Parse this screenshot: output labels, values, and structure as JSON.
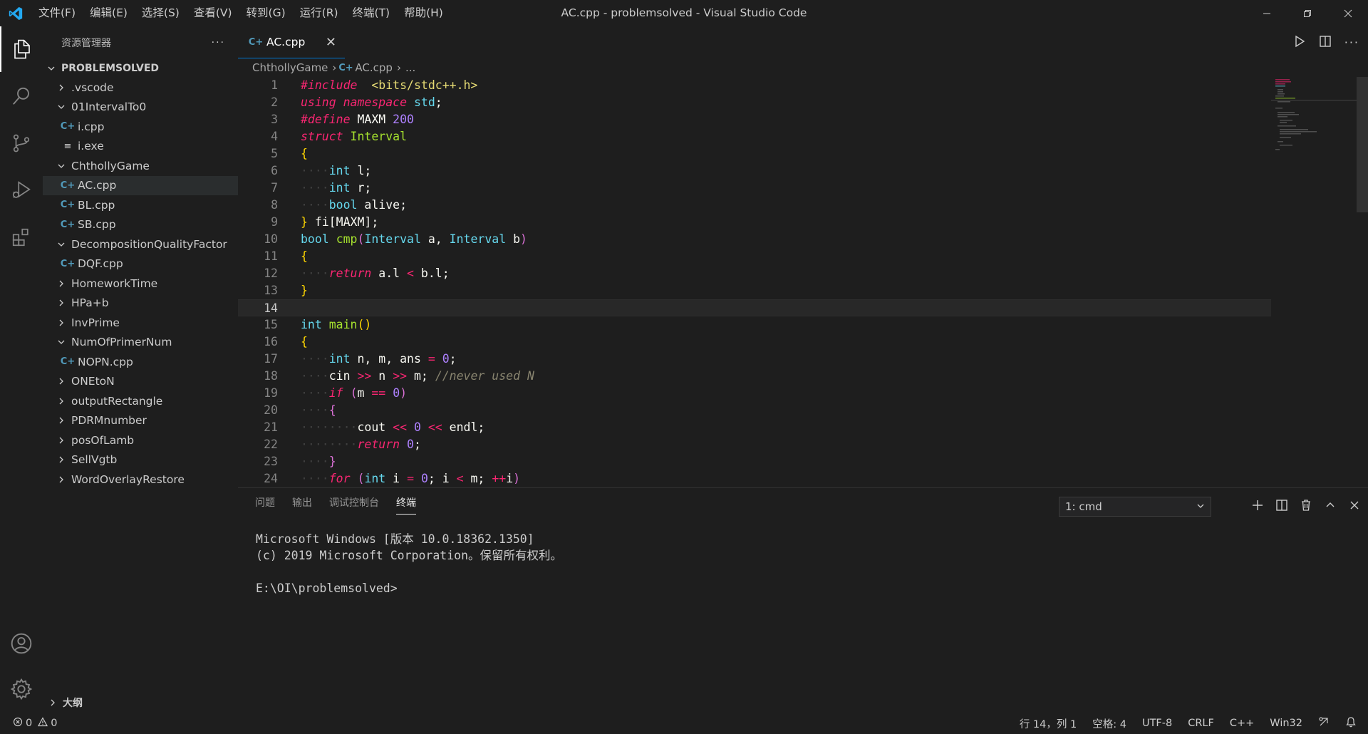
{
  "window": {
    "title": "AC.cpp - problemsolved - Visual Studio Code"
  },
  "menu": [
    "文件(F)",
    "编辑(E)",
    "选择(S)",
    "查看(V)",
    "转到(G)",
    "运行(R)",
    "终端(T)",
    "帮助(H)"
  ],
  "sidebar": {
    "header": "资源管理器",
    "section": "PROBLEMSOLVED",
    "tree": [
      {
        "label": ".vscode",
        "type": "folder",
        "expanded": false,
        "depth": 0
      },
      {
        "label": "01IntervalTo0",
        "type": "folder",
        "expanded": true,
        "depth": 0
      },
      {
        "label": "i.cpp",
        "type": "cpp",
        "depth": 1
      },
      {
        "label": "i.exe",
        "type": "exe",
        "depth": 1
      },
      {
        "label": "ChthollyGame",
        "type": "folder",
        "expanded": true,
        "depth": 0
      },
      {
        "label": "AC.cpp",
        "type": "cpp",
        "depth": 1,
        "selected": true
      },
      {
        "label": "BL.cpp",
        "type": "cpp",
        "depth": 1
      },
      {
        "label": "SB.cpp",
        "type": "cpp",
        "depth": 1
      },
      {
        "label": "DecompositionQualityFactor",
        "type": "folder",
        "expanded": true,
        "depth": 0
      },
      {
        "label": "DQF.cpp",
        "type": "cpp",
        "depth": 1
      },
      {
        "label": "HomeworkTime",
        "type": "folder",
        "expanded": false,
        "depth": 0
      },
      {
        "label": "HPa+b",
        "type": "folder",
        "expanded": false,
        "depth": 0
      },
      {
        "label": "InvPrime",
        "type": "folder",
        "expanded": false,
        "depth": 0
      },
      {
        "label": "NumOfPrimerNum",
        "type": "folder",
        "expanded": true,
        "depth": 0
      },
      {
        "label": "NOPN.cpp",
        "type": "cpp",
        "depth": 1
      },
      {
        "label": "ONEtoN",
        "type": "folder",
        "expanded": false,
        "depth": 0
      },
      {
        "label": "outputRectangle",
        "type": "folder",
        "expanded": false,
        "depth": 0
      },
      {
        "label": "PDRMnumber",
        "type": "folder",
        "expanded": false,
        "depth": 0
      },
      {
        "label": "posOfLamb",
        "type": "folder",
        "expanded": false,
        "depth": 0
      },
      {
        "label": "SellVgtb",
        "type": "folder",
        "expanded": false,
        "depth": 0
      },
      {
        "label": "WordOverlayRestore",
        "type": "folder",
        "expanded": false,
        "depth": 0
      }
    ],
    "outline": "大纲"
  },
  "editor": {
    "tab": "AC.cpp",
    "breadcrumb": [
      "ChthollyGame",
      "AC.cpp",
      "..."
    ],
    "current_line": 14,
    "lines": [
      [
        [
          "pp-it",
          "#include"
        ],
        [
          "",
          "  "
        ],
        [
          "str",
          "<bits/stdc++.h>"
        ]
      ],
      [
        [
          "kw-it",
          "using"
        ],
        [
          "",
          " "
        ],
        [
          "kw-it",
          "namespace"
        ],
        [
          "",
          " "
        ],
        [
          "type",
          "std"
        ],
        [
          "",
          ";"
        ]
      ],
      [
        [
          "pp-it",
          "#define"
        ],
        [
          "",
          " MAXM "
        ],
        [
          "num",
          "200"
        ]
      ],
      [
        [
          "kw-it",
          "struct"
        ],
        [
          "",
          " "
        ],
        [
          "fn",
          "Interval"
        ]
      ],
      [
        [
          "brace1",
          "{"
        ]
      ],
      [
        [
          "guide",
          "····"
        ],
        [
          "type",
          "int"
        ],
        [
          "",
          " l;"
        ]
      ],
      [
        [
          "guide",
          "····"
        ],
        [
          "type",
          "int"
        ],
        [
          "",
          " r;"
        ]
      ],
      [
        [
          "guide",
          "····"
        ],
        [
          "type",
          "bool"
        ],
        [
          "",
          " alive;"
        ]
      ],
      [
        [
          "brace1",
          "}"
        ],
        [
          "",
          " fi[MAXM];"
        ]
      ],
      [
        [
          "type",
          "bool"
        ],
        [
          "",
          " "
        ],
        [
          "fn",
          "cmp"
        ],
        [
          "brace2",
          "("
        ],
        [
          "type",
          "Interval"
        ],
        [
          "",
          " a, "
        ],
        [
          "type",
          "Interval"
        ],
        [
          "",
          " b"
        ],
        [
          "brace2",
          ")"
        ]
      ],
      [
        [
          "brace1",
          "{"
        ]
      ],
      [
        [
          "guide",
          "····"
        ],
        [
          "kw-it",
          "return"
        ],
        [
          "",
          " a.l "
        ],
        [
          "op",
          "<"
        ],
        [
          "",
          " b.l;"
        ]
      ],
      [
        [
          "brace1",
          "}"
        ]
      ],
      [],
      [
        [
          "type",
          "int"
        ],
        [
          "",
          " "
        ],
        [
          "fn",
          "main"
        ],
        [
          "brace1",
          "()"
        ]
      ],
      [
        [
          "brace1",
          "{"
        ]
      ],
      [
        [
          "guide",
          "····"
        ],
        [
          "type",
          "int"
        ],
        [
          "",
          " n, m, ans "
        ],
        [
          "op",
          "="
        ],
        [
          "",
          " "
        ],
        [
          "num",
          "0"
        ],
        [
          "",
          ";"
        ]
      ],
      [
        [
          "guide",
          "····"
        ],
        [
          "",
          "cin "
        ],
        [
          "op",
          ">>"
        ],
        [
          "",
          " n "
        ],
        [
          "op",
          ">>"
        ],
        [
          "",
          " m; "
        ],
        [
          "cmt",
          "//never used N"
        ]
      ],
      [
        [
          "guide",
          "····"
        ],
        [
          "kw-it",
          "if"
        ],
        [
          "",
          " "
        ],
        [
          "brace2",
          "("
        ],
        [
          "",
          "m "
        ],
        [
          "op",
          "=="
        ],
        [
          "",
          " "
        ],
        [
          "num",
          "0"
        ],
        [
          "brace2",
          ")"
        ]
      ],
      [
        [
          "guide",
          "····"
        ],
        [
          "brace2",
          "{"
        ]
      ],
      [
        [
          "guide",
          "········"
        ],
        [
          "",
          "cout "
        ],
        [
          "op",
          "<<"
        ],
        [
          "",
          " "
        ],
        [
          "num",
          "0"
        ],
        [
          "",
          " "
        ],
        [
          "op",
          "<<"
        ],
        [
          "",
          " endl;"
        ]
      ],
      [
        [
          "guide",
          "········"
        ],
        [
          "kw-it",
          "return"
        ],
        [
          "",
          " "
        ],
        [
          "num",
          "0"
        ],
        [
          "",
          ";"
        ]
      ],
      [
        [
          "guide",
          "····"
        ],
        [
          "brace2",
          "}"
        ]
      ],
      [
        [
          "guide",
          "····"
        ],
        [
          "kw-it",
          "for"
        ],
        [
          "",
          " "
        ],
        [
          "brace2",
          "("
        ],
        [
          "type",
          "int"
        ],
        [
          "",
          " i "
        ],
        [
          "op",
          "="
        ],
        [
          "",
          " "
        ],
        [
          "num",
          "0"
        ],
        [
          "",
          "; i "
        ],
        [
          "op",
          "<"
        ],
        [
          "",
          " m; "
        ],
        [
          "op",
          "++"
        ],
        [
          "",
          "i"
        ],
        [
          "brace2",
          ")"
        ]
      ],
      [
        [
          "guide",
          "····"
        ],
        [
          "brace2",
          "{"
        ]
      ]
    ]
  },
  "panel": {
    "tabs": [
      "问题",
      "输出",
      "调试控制台",
      "终端"
    ],
    "active_tab": "终端",
    "terminal_select": "1: cmd",
    "terminal_lines": [
      "Microsoft Windows [版本 10.0.18362.1350]",
      "(c) 2019 Microsoft Corporation。保留所有权利。",
      "",
      "E:\\OI\\problemsolved>"
    ]
  },
  "status": {
    "errors": "0",
    "warnings": "0",
    "position": "行 14，列 1",
    "spaces": "空格: 4",
    "encoding": "UTF-8",
    "eol": "CRLF",
    "language": "C++",
    "platform": "Win32"
  },
  "colors": {
    "accent": "#0078d4",
    "vscode_blue": "#23a9f2"
  }
}
